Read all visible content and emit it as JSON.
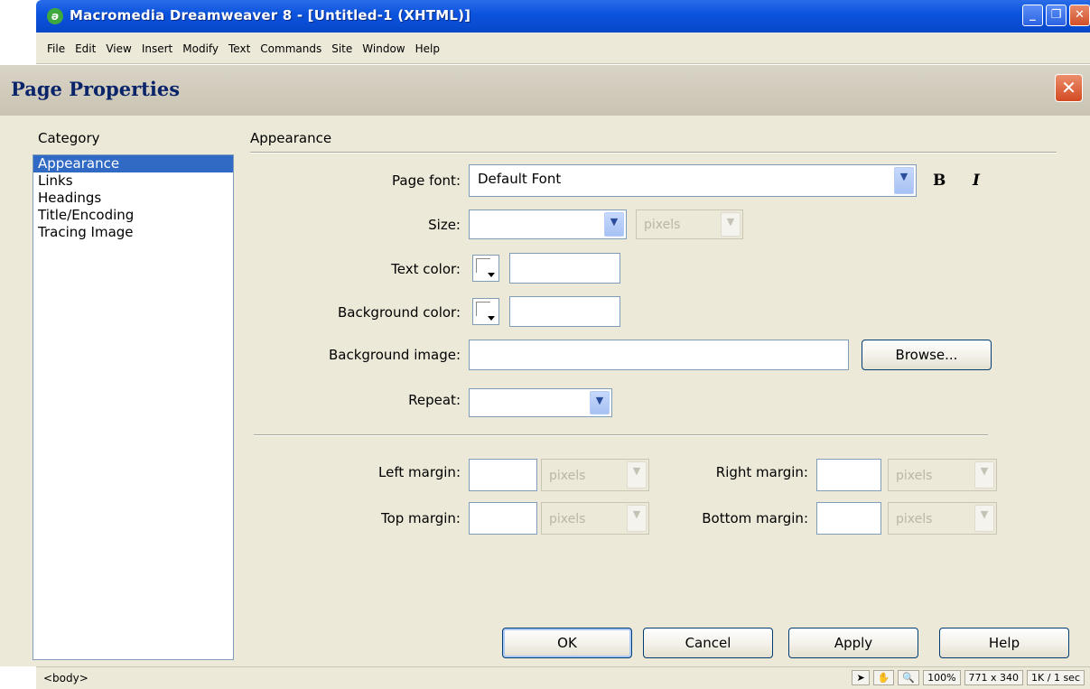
{
  "app": {
    "title": "Macromedia Dreamweaver 8 - [Untitled-1 (XHTML)]",
    "icon": "dreamweaver-logo-icon",
    "window_buttons": {
      "minimize": "_",
      "restore": "❐",
      "close": "✕"
    },
    "menu": [
      "File",
      "Edit",
      "View",
      "Insert",
      "Modify",
      "Text",
      "Commands",
      "Site",
      "Window",
      "Help"
    ]
  },
  "dialog": {
    "title": "Page Properties",
    "close_glyph": "✕",
    "category_label": "Category",
    "categories": [
      "Appearance",
      "Links",
      "Headings",
      "Title/Encoding",
      "Tracing Image"
    ],
    "selected_category": "Appearance",
    "section_title": "Appearance",
    "page_font": {
      "label": "Page font:",
      "value": "Default Font",
      "bold": "B",
      "italic": "I"
    },
    "size": {
      "label": "Size:",
      "value": "",
      "unit": "pixels"
    },
    "text_color": {
      "label": "Text color:",
      "value": ""
    },
    "background_color": {
      "label": "Background color:",
      "value": ""
    },
    "background_image": {
      "label": "Background image:",
      "value": "",
      "browse": "Browse..."
    },
    "repeat": {
      "label": "Repeat:",
      "value": ""
    },
    "margins": {
      "left": {
        "label": "Left margin:",
        "value": "",
        "unit": "pixels"
      },
      "right": {
        "label": "Right margin:",
        "value": "",
        "unit": "pixels"
      },
      "top": {
        "label": "Top margin:",
        "value": "",
        "unit": "pixels"
      },
      "bottom": {
        "label": "Bottom margin:",
        "value": "",
        "unit": "pixels"
      }
    },
    "buttons": {
      "ok": "OK",
      "cancel": "Cancel",
      "apply": "Apply",
      "help": "Help"
    }
  },
  "status_bar": {
    "tag": "<body>",
    "zoom": "100%",
    "size": "771 x 340",
    "download": "1K / 1 sec"
  },
  "colors": {
    "selection": "#316ac5",
    "titlebar": "#0a52dd",
    "dialog_bg": "#ece9d8"
  }
}
